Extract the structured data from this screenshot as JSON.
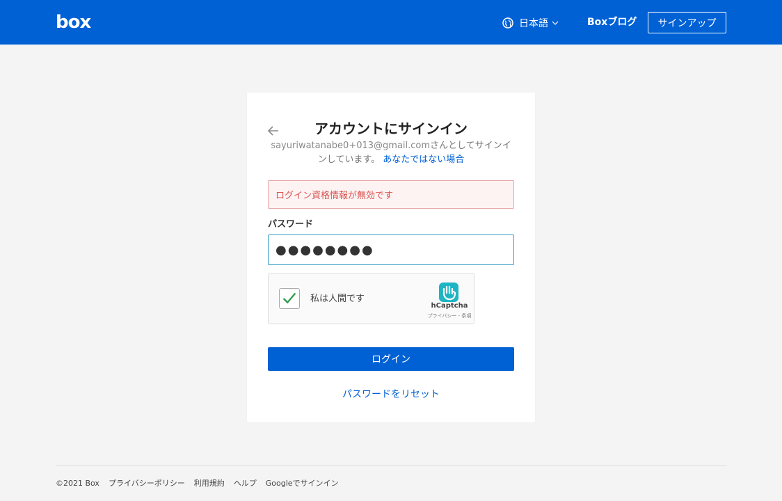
{
  "header": {
    "logo": "box",
    "language": "日本語",
    "blog": "Boxブログ",
    "signup": "サインアップ"
  },
  "card": {
    "title": "アカウントにサインイン",
    "email": "sayuriwatanabe0+013@gmail.com",
    "subtitle_suffix": "さんとしてサインインしています。",
    "not_you": "あなたではない場合",
    "error": "ログイン資格情報が無効です",
    "password_label": "パスワード",
    "password_value": "●●●●●●●●",
    "captcha": {
      "label": "私は人間です",
      "brand": "hCaptcha",
      "privacy": "プライバシー",
      "separator": " - ",
      "terms": "条項"
    },
    "login_button": "ログイン",
    "reset_link": "パスワードをリセット"
  },
  "footer": {
    "copyright": "©2021 Box",
    "privacy": "プライバシーポリシー",
    "terms": "利用規約",
    "help": "ヘルプ",
    "google": "Googleでサインイン"
  },
  "colors": {
    "brand": "#0061d5",
    "error_text": "#d9534f",
    "error_bg": "#fdf3f3",
    "error_border": "#e8a6a6",
    "check": "#2e9e4f",
    "captcha": "#1eb4c4"
  },
  "icons": {
    "language": "globe-icon",
    "language_toggle": "chevron-down-icon",
    "back": "arrow-left-icon",
    "check": "checkmark-icon",
    "captcha": "hcaptcha-logo-icon"
  }
}
